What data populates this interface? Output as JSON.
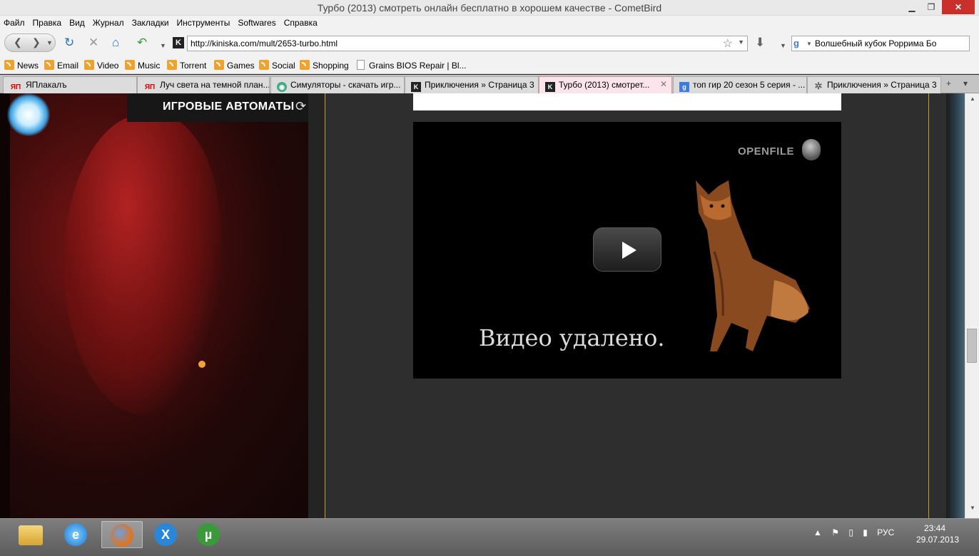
{
  "window": {
    "title": "Турбо (2013) смотреть онлайн бесплатно в хорошем качестве - CometBird",
    "min_glyph": "▁",
    "max_glyph": "❐",
    "close_glyph": "✕"
  },
  "menu": [
    "Файл",
    "Правка",
    "Вид",
    "Журнал",
    "Закладки",
    "Инструменты",
    "Softwares",
    "Справка"
  ],
  "nav": {
    "url": "http://kiniska.com/mult/2653-turbo.html",
    "search_value": "Волшебный кубок Роррима Бо",
    "site_icon_glyph": "K",
    "search_engine_glyph": "g"
  },
  "bookmarks": [
    "News",
    "Email",
    "Video",
    "Music",
    "Torrent",
    "Games",
    "Social",
    "Shopping",
    "Grains BIOS Repair | Bl..."
  ],
  "tabs": [
    {
      "label": "ЯПлакалъ",
      "icon": "yaplakal-icon",
      "glyph": "ЯП",
      "active": false
    },
    {
      "label": "Луч света на темной план...",
      "icon": "yaplakal-icon",
      "glyph": "ЯП",
      "active": false
    },
    {
      "label": "Симуляторы - скачать игр...",
      "icon": "simulators-icon",
      "glyph": "◉",
      "active": false
    },
    {
      "label": "Приключения » Страница 3",
      "icon": "kiniska-icon",
      "glyph": "K",
      "active": false
    },
    {
      "label": "Турбо (2013) смотрет...",
      "icon": "kiniska-icon",
      "glyph": "K",
      "active": true
    },
    {
      "label": "топ гир 20 сезон 5 серия - ...",
      "icon": "google-icon",
      "glyph": "g",
      "active": false
    },
    {
      "label": "Приключения » Страница 3",
      "icon": "gear-site-icon",
      "glyph": "✲",
      "active": false
    }
  ],
  "page": {
    "banner_text": "ИГРОВЫЕ АВТОМАТЫ",
    "video_brand": "OPENFILE",
    "video_message": "Видео удалено."
  },
  "taskbar": {
    "apps": [
      "file-explorer",
      "internet-explorer",
      "cometbird",
      "xlite",
      "utorrent"
    ],
    "language": "РУС",
    "time": "23:44",
    "date": "29.07.2013"
  },
  "colors": {
    "accent_gold": "#c99a2a",
    "active_tab": "#fbe4ec",
    "close_button": "#c9302c"
  }
}
